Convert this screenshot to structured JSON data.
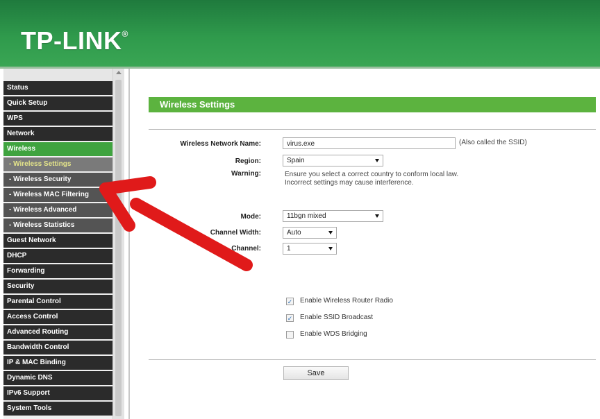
{
  "brand": {
    "logo": "TP-LINK"
  },
  "sidebar": {
    "items": [
      {
        "label": "Status"
      },
      {
        "label": "Quick Setup"
      },
      {
        "label": "WPS"
      },
      {
        "label": "Network"
      },
      {
        "label": "Wireless"
      },
      {
        "label": "- Wireless Settings"
      },
      {
        "label": "- Wireless Security"
      },
      {
        "label": "- Wireless MAC Filtering"
      },
      {
        "label": "- Wireless Advanced"
      },
      {
        "label": "- Wireless Statistics"
      },
      {
        "label": "Guest Network"
      },
      {
        "label": "DHCP"
      },
      {
        "label": "Forwarding"
      },
      {
        "label": "Security"
      },
      {
        "label": "Parental Control"
      },
      {
        "label": "Access Control"
      },
      {
        "label": "Advanced Routing"
      },
      {
        "label": "Bandwidth Control"
      },
      {
        "label": "IP & MAC Binding"
      },
      {
        "label": "Dynamic DNS"
      },
      {
        "label": "IPv6 Support"
      },
      {
        "label": "System Tools"
      }
    ]
  },
  "main": {
    "title": "Wireless Settings",
    "network_name_label": "Wireless Network Name:",
    "network_name_value": "virus.exe",
    "ssid_note": "(Also called the SSID)",
    "region_label": "Region:",
    "region_value": "Spain",
    "warning_label": "Warning:",
    "warning_line1": "Ensure you select a correct country to conform local law.",
    "warning_line2": "Incorrect settings may cause interference.",
    "mode_label": "Mode:",
    "mode_value": "11bgn mixed",
    "channel_width_label": "Channel Width:",
    "channel_width_value": "Auto",
    "channel_label": "Channel:",
    "channel_value": "1",
    "checkboxes": [
      {
        "label": "Enable Wireless Router Radio",
        "checked": true
      },
      {
        "label": "Enable SSID Broadcast",
        "checked": true
      },
      {
        "label": "Enable WDS Bridging",
        "checked": false
      }
    ],
    "save_label": "Save"
  },
  "colors": {
    "brand_green": "#2f9a4c",
    "accent_green": "#5cb33f",
    "annotation_red": "#e01a1a"
  }
}
